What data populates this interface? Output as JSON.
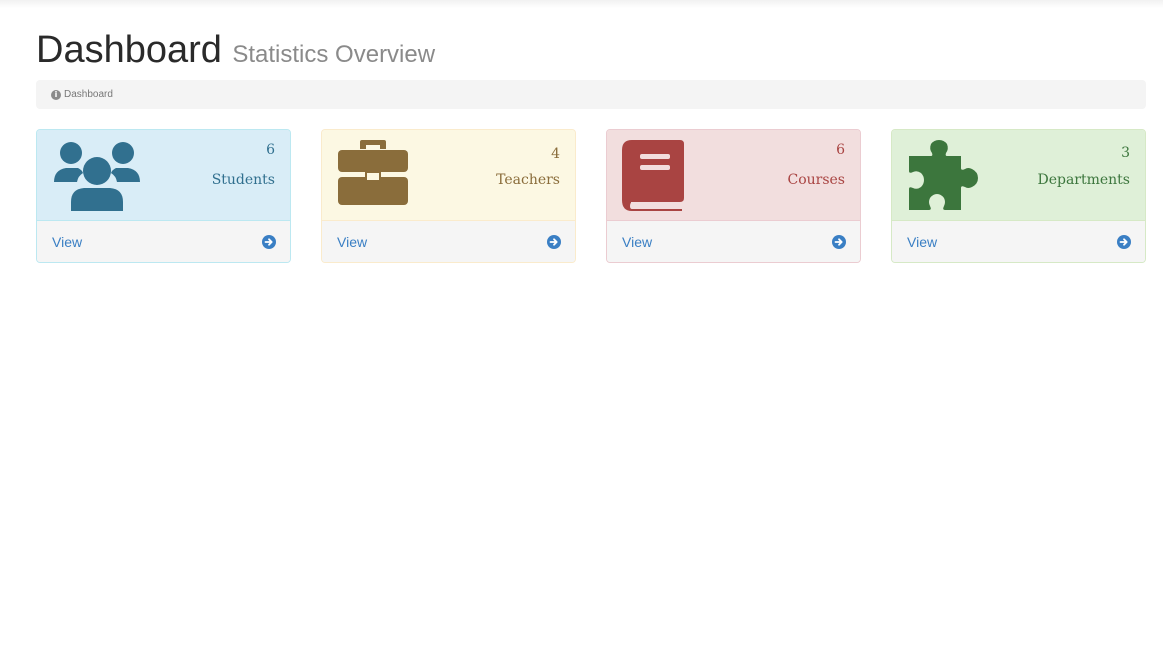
{
  "header": {
    "title": "Dashboard",
    "subtitle": "Statistics Overview"
  },
  "breadcrumb": {
    "icon": "info-circle-icon",
    "label": "Dashboard"
  },
  "cards": [
    {
      "count": "6",
      "label": "Students",
      "link": "View",
      "icon": "users-icon",
      "bg": "#d9edf7",
      "border": "#bce8f1",
      "color": "#31708f"
    },
    {
      "count": "4",
      "label": "Teachers",
      "link": "View",
      "icon": "briefcase-icon",
      "bg": "#fcf8e3",
      "border": "#faebcc",
      "color": "#8a6d3b"
    },
    {
      "count": "6",
      "label": "Courses",
      "link": "View",
      "icon": "book-icon",
      "bg": "#f2dede",
      "border": "#ebccd1",
      "color": "#a94442"
    },
    {
      "count": "3",
      "label": "Departments",
      "link": "View",
      "icon": "puzzle-piece-icon",
      "bg": "#dff0d8",
      "border": "#d6e9c6",
      "color": "#3c763d"
    }
  ],
  "colors": {
    "link": "#3a7fc4",
    "footer_bg": "#f5f5f5"
  }
}
